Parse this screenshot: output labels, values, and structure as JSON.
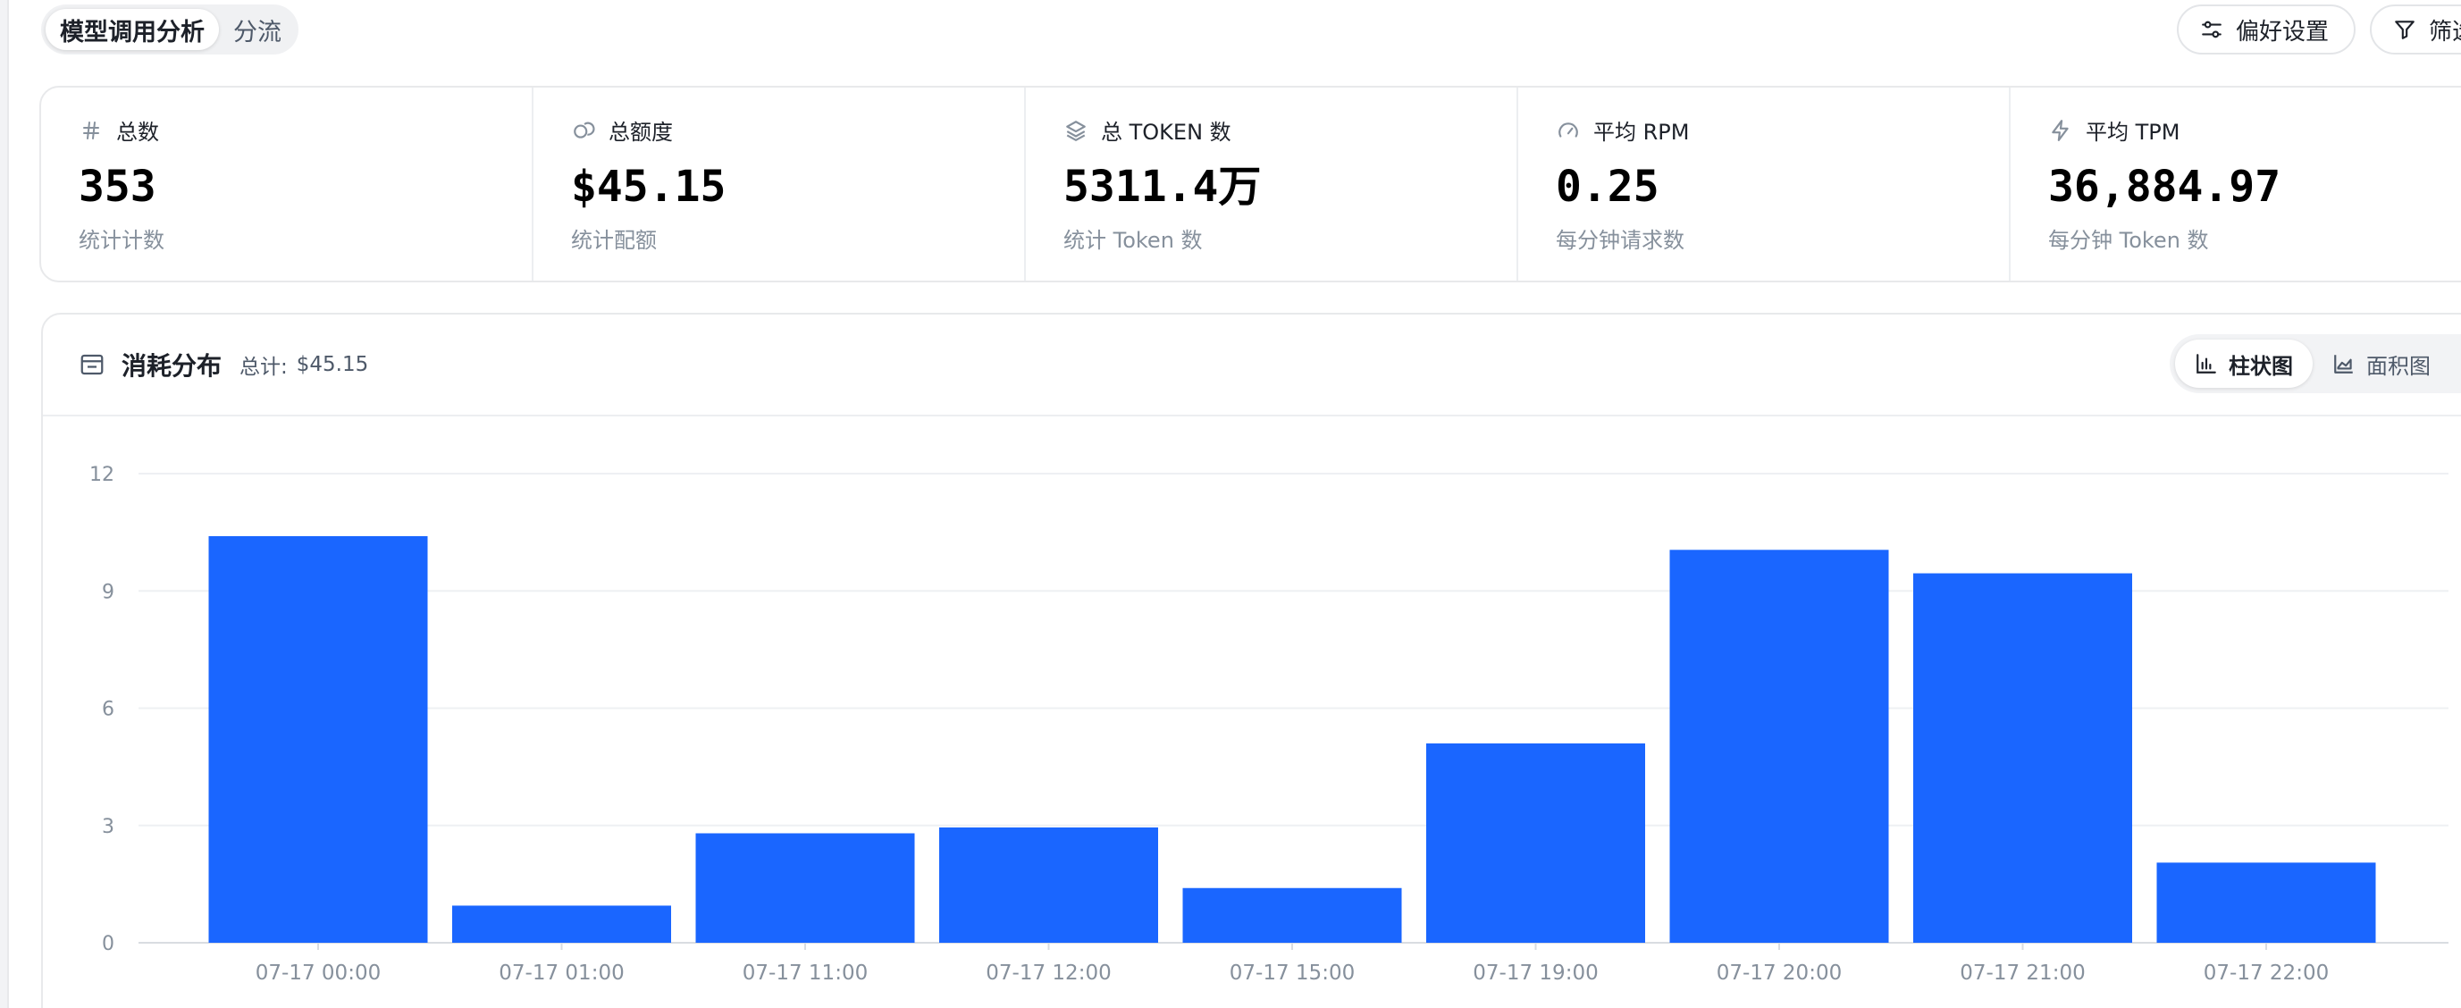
{
  "tabs": [
    {
      "label": "模型调用分析",
      "active": true
    },
    {
      "label": "分流",
      "active": false
    }
  ],
  "toolbar": {
    "preferences_label": "偏好设置",
    "filter_label": "筛选"
  },
  "stats": [
    {
      "icon": "hash-icon",
      "title": "总数",
      "value": "353",
      "subtitle": "统计计数"
    },
    {
      "icon": "coins-icon",
      "title": "总额度",
      "value": "$45.15",
      "subtitle": "统计配额"
    },
    {
      "icon": "layers-icon",
      "title": "总 TOKEN 数",
      "value": "5311.4万",
      "subtitle": "统计 Token 数"
    },
    {
      "icon": "gauge-icon",
      "title": "平均 RPM",
      "value": "0.25",
      "subtitle": "每分钟请求数"
    },
    {
      "icon": "bolt-icon",
      "title": "平均 TPM",
      "value": "36,884.97",
      "subtitle": "每分钟 Token 数"
    }
  ],
  "chart_panel": {
    "icon": "wallet-icon",
    "title": "消耗分布",
    "total_label": "总计:",
    "total_value": "$45.15",
    "toggle": [
      {
        "icon": "bar-chart-icon",
        "label": "柱状图",
        "active": true
      },
      {
        "icon": "area-chart-icon",
        "label": "面积图",
        "active": false
      }
    ]
  },
  "colors": {
    "accent": "#1a66ff",
    "grid": "#eef0f3",
    "muted_text": "#86909c"
  },
  "chart_data": {
    "type": "bar",
    "categories": [
      "07-17 00:00",
      "07-17 01:00",
      "07-17 11:00",
      "07-17 12:00",
      "07-17 15:00",
      "07-17 19:00",
      "07-17 20:00",
      "07-17 21:00",
      "07-17 22:00"
    ],
    "values": [
      10.4,
      0.95,
      2.8,
      2.95,
      1.4,
      5.1,
      10.05,
      9.45,
      2.05
    ],
    "yticks": [
      0,
      3,
      6,
      9,
      12
    ],
    "ylim": [
      0,
      12
    ],
    "grid": true,
    "legend": "none"
  }
}
